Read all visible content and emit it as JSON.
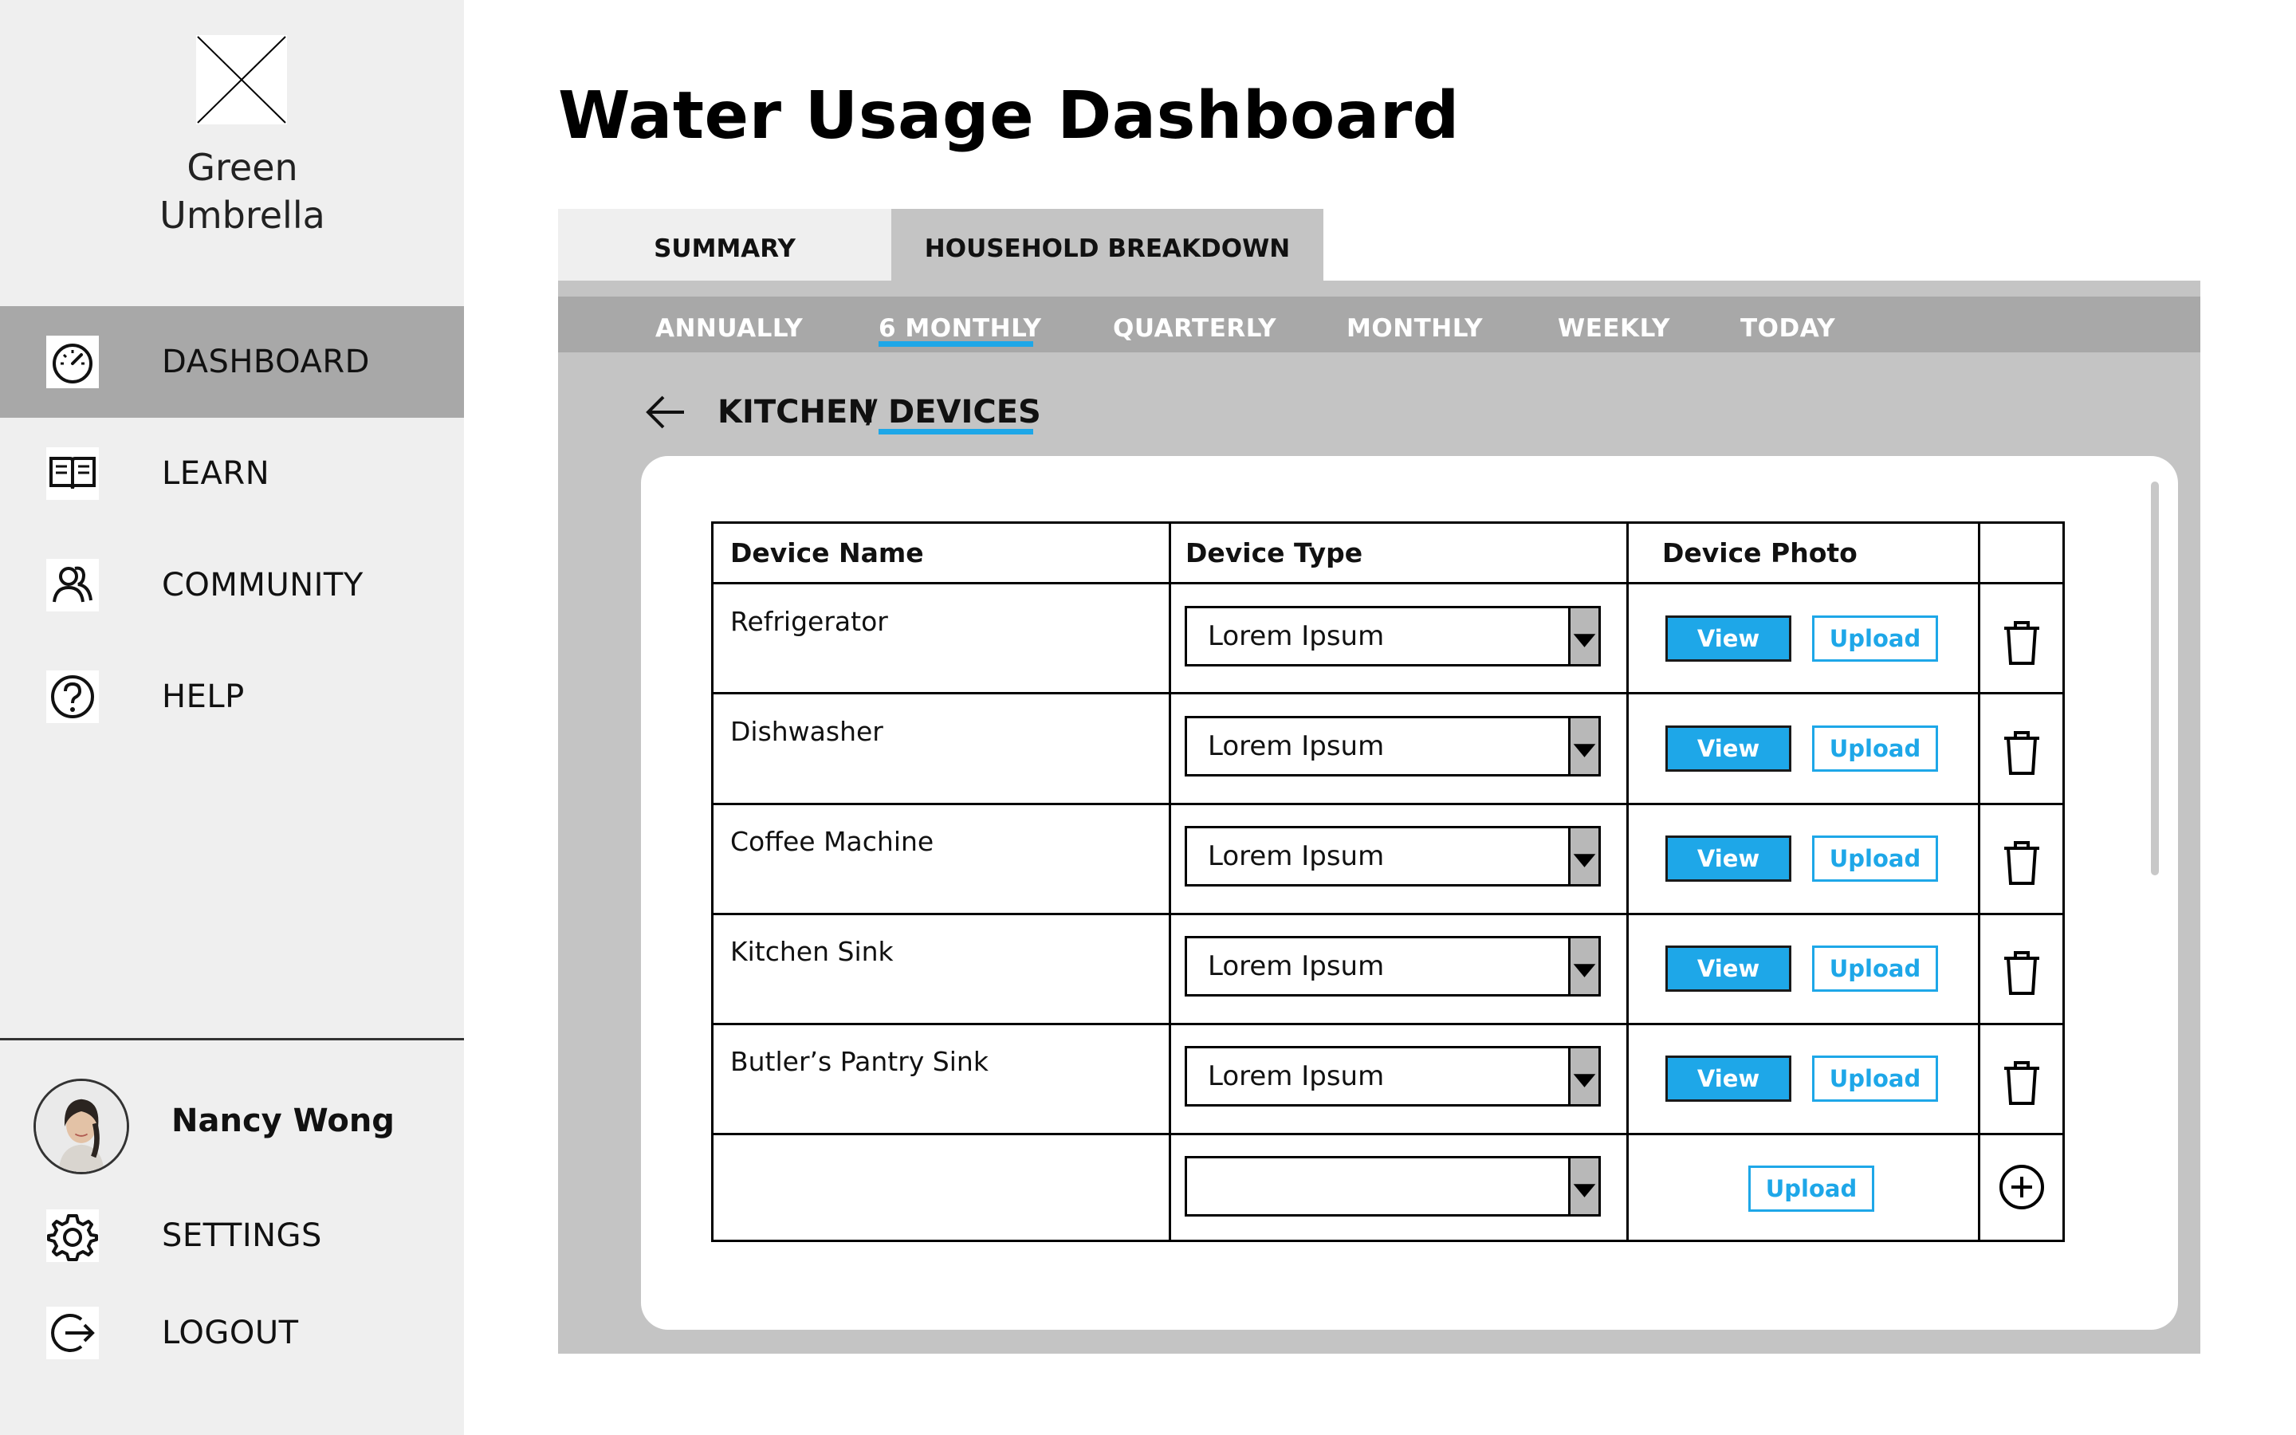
{
  "sidebar": {
    "brand": "Green\nUmbrella",
    "logo_icon": "placeholder-image-icon",
    "nav": [
      {
        "label": "DASHBOARD",
        "icon": "gauge-icon",
        "active": true
      },
      {
        "label": "LEARN",
        "icon": "book-icon",
        "active": false
      },
      {
        "label": "COMMUNITY",
        "icon": "people-icon",
        "active": false
      },
      {
        "label": "HELP",
        "icon": "help-icon",
        "active": false
      }
    ],
    "user": {
      "name": "Nancy Wong"
    },
    "settings_label": "SETTINGS",
    "logout_label": "LOGOUT"
  },
  "header": {
    "title": "Water Usage Dashboard"
  },
  "tabs": [
    {
      "label": "SUMMARY",
      "active": false
    },
    {
      "label": "HOUSEHOLD BREAKDOWN",
      "active": true
    }
  ],
  "periods": [
    {
      "label": "ANNUALLY",
      "active": false
    },
    {
      "label": "6 MONTHLY",
      "active": true
    },
    {
      "label": "QUARTERLY",
      "active": false
    },
    {
      "label": "MONTHLY",
      "active": false
    },
    {
      "label": "WEEKLY",
      "active": false
    },
    {
      "label": "TODAY",
      "active": false
    }
  ],
  "breadcrumb": {
    "parent": "KITCHEN",
    "separator": "/",
    "current": "DEVICES"
  },
  "table": {
    "headers": [
      "Device Name",
      "Device Type",
      "Device Photo",
      ""
    ],
    "rows": [
      {
        "name": "Refrigerator",
        "type": "Lorem Ipsum"
      },
      {
        "name": "Dishwasher",
        "type": "Lorem Ipsum"
      },
      {
        "name": "Coffee Machine",
        "type": "Lorem Ipsum"
      },
      {
        "name": "Kitchen Sink",
        "type": "Lorem Ipsum"
      },
      {
        "name": "Butler’s Pantry Sink",
        "type": "Lorem Ipsum"
      }
    ],
    "new_row": {
      "name": "",
      "type": ""
    },
    "view_label": "View",
    "upload_label": "Upload"
  },
  "colors": {
    "accent": "#1ea7e8",
    "sidebar_bg": "#efefef",
    "active_nav": "#a8a8a8",
    "panel": "#c4c4c4"
  }
}
